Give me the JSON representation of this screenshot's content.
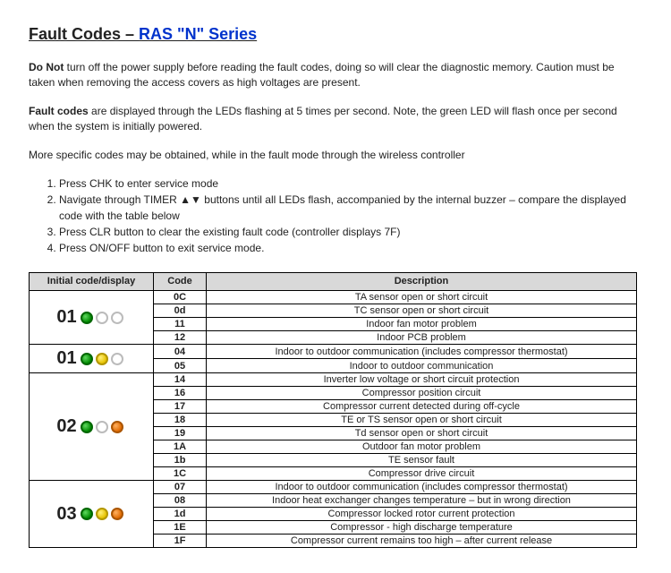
{
  "title": {
    "prefix": "Fault Codes – ",
    "link_text": "RAS \"N\" Series"
  },
  "intro": [
    {
      "lead": "Do Not",
      "rest": " turn off the power supply before reading the fault codes, doing so will clear the diagnostic memory.  Caution must be taken when removing the access covers as high voltages are present."
    },
    {
      "lead": "Fault codes",
      "rest": " are displayed through the LEDs flashing at 5 times per second.  Note, the green LED will flash once per second when the system is initially powered."
    }
  ],
  "steps_intro": "More specific codes may be obtained, while in the fault mode through the wireless controller",
  "steps": [
    "Press CHK to enter service mode",
    "Navigate through TIMER ▲▼ buttons until all LEDs flash, accompanied by the internal buzzer – compare the displayed code with the table below",
    "Press CLR button to clear the existing fault code (controller displays 7F)",
    "Press ON/OFF button to exit service mode."
  ],
  "headers": {
    "initial": "Initial code/display",
    "code": "Code",
    "description": "Description"
  },
  "groups": [
    {
      "display_num": "01",
      "leds": [
        "green",
        "off",
        "off"
      ],
      "rows": [
        {
          "code": "0C",
          "desc": "TA sensor open or short circuit"
        },
        {
          "code": "0d",
          "desc": "TC sensor open or short circuit"
        },
        {
          "code": "11",
          "desc": "Indoor fan motor problem"
        },
        {
          "code": "12",
          "desc": "Indoor PCB problem"
        }
      ]
    },
    {
      "display_num": "01",
      "leds": [
        "green",
        "yellow",
        "off"
      ],
      "rows": [
        {
          "code": "04",
          "desc": "Indoor to outdoor communication (includes compressor thermostat)"
        },
        {
          "code": "05",
          "desc": "Indoor to outdoor communication"
        }
      ]
    },
    {
      "display_num": "02",
      "leds": [
        "green",
        "off",
        "orange"
      ],
      "rows": [
        {
          "code": "14",
          "desc": "Inverter low voltage or short circuit protection"
        },
        {
          "code": "16",
          "desc": "Compressor position circuit"
        },
        {
          "code": "17",
          "desc": "Compressor current detected during off-cycle"
        },
        {
          "code": "18",
          "desc": "TE or TS sensor open or short circuit"
        },
        {
          "code": "19",
          "desc": "Td sensor open or short circuit"
        },
        {
          "code": "1A",
          "desc": "Outdoor fan motor problem"
        },
        {
          "code": "1b",
          "desc": "TE sensor fault"
        },
        {
          "code": "1C",
          "desc": "Compressor drive circuit"
        }
      ]
    },
    {
      "display_num": "03",
      "leds": [
        "green",
        "yellow",
        "orange"
      ],
      "rows": [
        {
          "code": "07",
          "desc": "Indoor to outdoor communication (includes compressor thermostat)"
        },
        {
          "code": "08",
          "desc": "Indoor heat exchanger changes temperature – but in wrong direction"
        },
        {
          "code": "1d",
          "desc": "Compressor locked rotor current protection"
        },
        {
          "code": "1E",
          "desc": "Compressor - high discharge temperature"
        },
        {
          "code": "1F",
          "desc": "Compressor current remains too high – after current release"
        }
      ]
    }
  ]
}
